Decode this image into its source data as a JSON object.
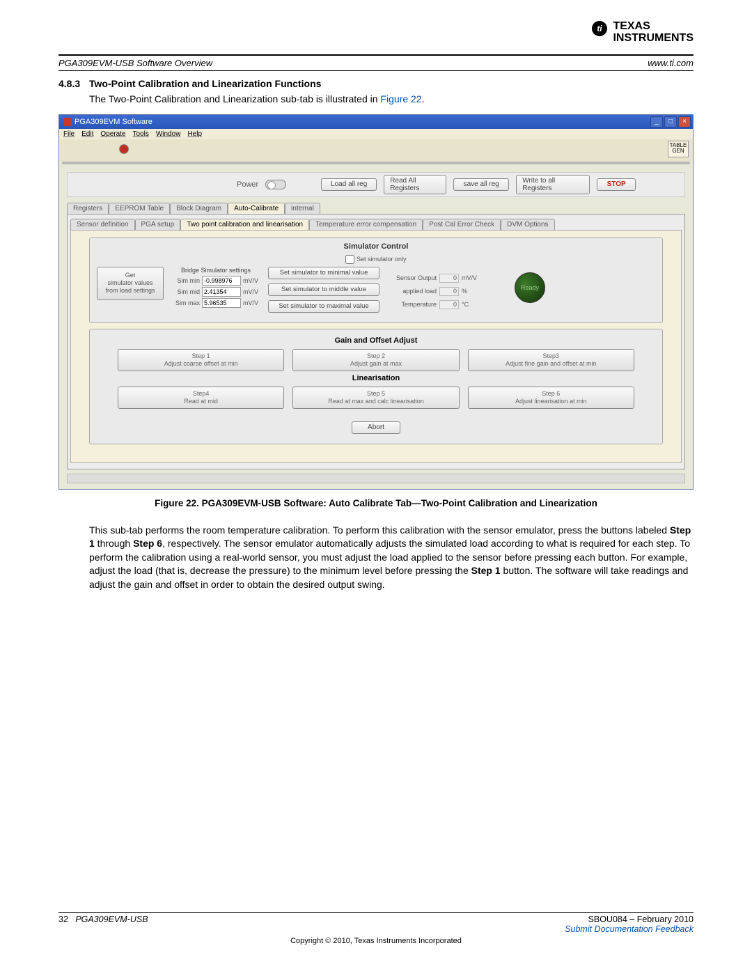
{
  "logo": {
    "brand_top": "TEXAS",
    "brand_bottom": "INSTRUMENTS"
  },
  "header": {
    "left": "PGA309EVM-USB Software Overview",
    "right": "www.ti.com"
  },
  "section": {
    "number": "4.8.3",
    "title": "Two-Point Calibration and Linearization Functions"
  },
  "intro": {
    "pre": "The Two-Point Calibration and Linearization sub-tab is illustrated in ",
    "link": "Figure 22",
    "post": "."
  },
  "figure_caption": "Figure 22. PGA309EVM-USB Software: Auto Calibrate Tab—Two-Point Calibration and Linearization",
  "body_text": {
    "p1a": "This sub-tab performs the room temperature calibration. To perform this calibration with the sensor emulator, press the buttons labeled ",
    "b1": "Step 1",
    "p1b": " through ",
    "b2": "Step 6",
    "p1c": ", respectively. The sensor emulator automatically adjusts the simulated load according to what is required for each step. To perform the calibration using a real-world sensor, you must adjust the load applied to the sensor before pressing each button. For example, adjust the load (that is, decrease the pressure) to the minimum level before pressing the ",
    "b3": "Step 1",
    "p1d": " button. The software will take readings and adjust the gain and offset in order to obtain the desired output swing."
  },
  "footer": {
    "page": "32",
    "title": "PGA309EVM-USB",
    "doc": "SBOU084 – February 2010",
    "feedback": "Submit Documentation Feedback",
    "copyright": "Copyright © 2010, Texas Instruments Incorporated"
  },
  "win": {
    "title": "PGA309EVM Software",
    "menus": [
      "File",
      "Edit",
      "Operate",
      "Tools",
      "Window",
      "Help"
    ],
    "table_gen": "TABLE\nGEN",
    "toolbar": {
      "power": "Power",
      "load_all": "Load all reg",
      "read_all": "Read All Registers",
      "save_all": "save all reg",
      "write_all": "Write to all Registers",
      "stop": "STOP"
    },
    "tabs": [
      "Registers",
      "EEPROM Table",
      "Block Diagram",
      "Auto-Calibrate",
      "internal"
    ],
    "tabs_active": 3,
    "sub_tabs": [
      "Sensor definition",
      "PGA setup",
      "Two point calibration and linearisation",
      "Temperature error compensation",
      "Post Cal Error Check",
      "DVM Options"
    ],
    "sub_tabs_active": 2,
    "sim": {
      "title": "Simulator Control",
      "chk": "Set simulator only",
      "get_btn": "Get\nsimulator values\nfrom load settings",
      "bridge_hdr": "Bridge Simulator settings",
      "rows": [
        {
          "label": "Sim min",
          "value": "-0.998976",
          "unit": "mV/V"
        },
        {
          "label": "Sim mid",
          "value": "2.41354",
          "unit": "mV/V"
        },
        {
          "label": "Sim max",
          "value": "5.96535",
          "unit": "mV/V"
        }
      ],
      "set_min": "Set simulator to minimal value",
      "set_mid": "Set simulator to middle value",
      "set_max": "Set simulator to maximal value",
      "readouts": [
        {
          "label": "Sensor Output",
          "value": "0",
          "unit": "mV/V"
        },
        {
          "label": "applied load",
          "value": "0",
          "unit": "%"
        },
        {
          "label": "Temperature",
          "value": "0",
          "unit": "°C"
        }
      ],
      "led": "Ready"
    },
    "gain": {
      "title": "Gain and Offset Adjust",
      "steps": [
        {
          "t": "Step 1",
          "sub": "Adjust coarse offset at min"
        },
        {
          "t": "Step 2",
          "sub": "Adjust gain at max"
        },
        {
          "t": "Step3",
          "sub": "Adjust fine gain and offset at min"
        }
      ]
    },
    "lin": {
      "title": "Linearisation",
      "steps": [
        {
          "t": "Step4",
          "sub": "Read at mid"
        },
        {
          "t": "Step 5",
          "sub": "Read at max and calc linearisation"
        },
        {
          "t": "Step 6",
          "sub": "Adjust linearisation at min"
        }
      ]
    },
    "abort": "Abort"
  }
}
